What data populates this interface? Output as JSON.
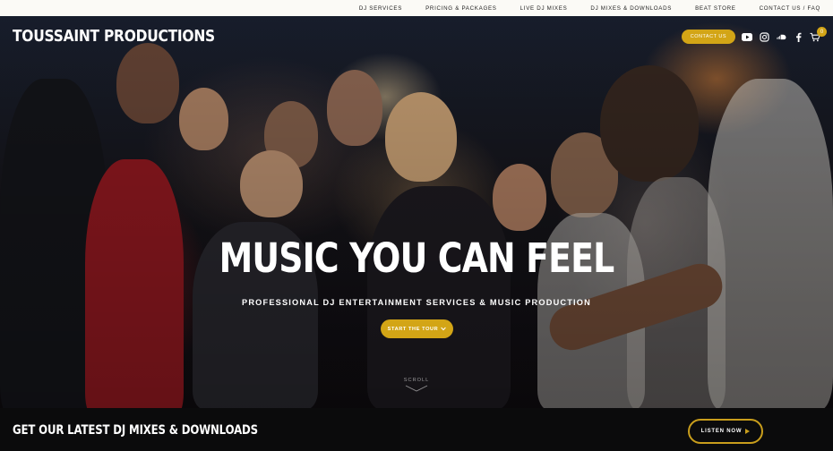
{
  "nav": {
    "items": [
      {
        "label": "DJ SERVICES"
      },
      {
        "label": "PRICING & PACKAGES"
      },
      {
        "label": "LIVE DJ MIXES"
      },
      {
        "label": "DJ MIXES & DOWNLOADS"
      },
      {
        "label": "BEAT STORE"
      },
      {
        "label": "CONTACT US / FAQ"
      }
    ]
  },
  "header": {
    "brand": "TOUSSAINT PRODUCTIONS",
    "contact_label": "CONTACT US",
    "social_icons": [
      "youtube-icon",
      "instagram-icon",
      "soundcloud-icon",
      "facebook-icon"
    ],
    "cart_count": "0"
  },
  "hero": {
    "headline": "MUSIC YOU CAN FEEL",
    "subheadline": "PROFESSIONAL DJ ENTERTAINMENT SERVICES & MUSIC PRODUCTION",
    "cta_label": "START THE TOUR",
    "scroll_label": "SCROLL"
  },
  "footer_bar": {
    "title": "GET OUR LATEST DJ MIXES & DOWNLOADS",
    "cta_label": "LISTEN NOW"
  },
  "colors": {
    "accent": "#d3a516",
    "nav_bg": "#fbfaf6",
    "bar_bg": "#0b0b0c"
  }
}
